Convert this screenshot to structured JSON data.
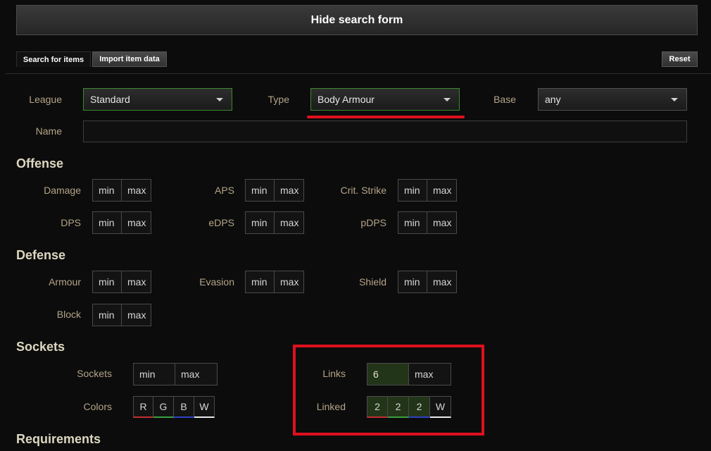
{
  "header": {
    "hide_label": "Hide search form"
  },
  "tabs": [
    {
      "label": "Search for items"
    },
    {
      "label": "Import item data"
    }
  ],
  "reset_label": "Reset",
  "filters": {
    "league": {
      "label": "League",
      "value": "Standard"
    },
    "type": {
      "label": "Type",
      "value": "Body Armour"
    },
    "base": {
      "label": "Base",
      "value": "any"
    },
    "name": {
      "label": "Name",
      "value": ""
    }
  },
  "placeholders": {
    "min": "min",
    "max": "max"
  },
  "offense": {
    "title": "Offense",
    "damage": "Damage",
    "aps": "APS",
    "crit": "Crit. Strike",
    "dps": "DPS",
    "edps": "eDPS",
    "pdps": "pDPS"
  },
  "defense": {
    "title": "Defense",
    "armour": "Armour",
    "evasion": "Evasion",
    "shield": "Shield",
    "block": "Block"
  },
  "sockets": {
    "title": "Sockets",
    "sockets_label": "Sockets",
    "colors_label": "Colors",
    "colors": [
      "R",
      "G",
      "B",
      "W"
    ],
    "links_label": "Links",
    "links_min": "6",
    "linked_label": "Linked",
    "linked_values": [
      "2",
      "2",
      "2",
      "W"
    ]
  },
  "requirements": {
    "title": "Requirements"
  },
  "colors": {
    "socket_red": "#c03030",
    "socket_green": "#3aa040",
    "socket_blue": "#3040c8",
    "socket_white": "#e8e8e8",
    "highlight_border": "#3c8a2a",
    "annotation_red": "#e0101e"
  }
}
